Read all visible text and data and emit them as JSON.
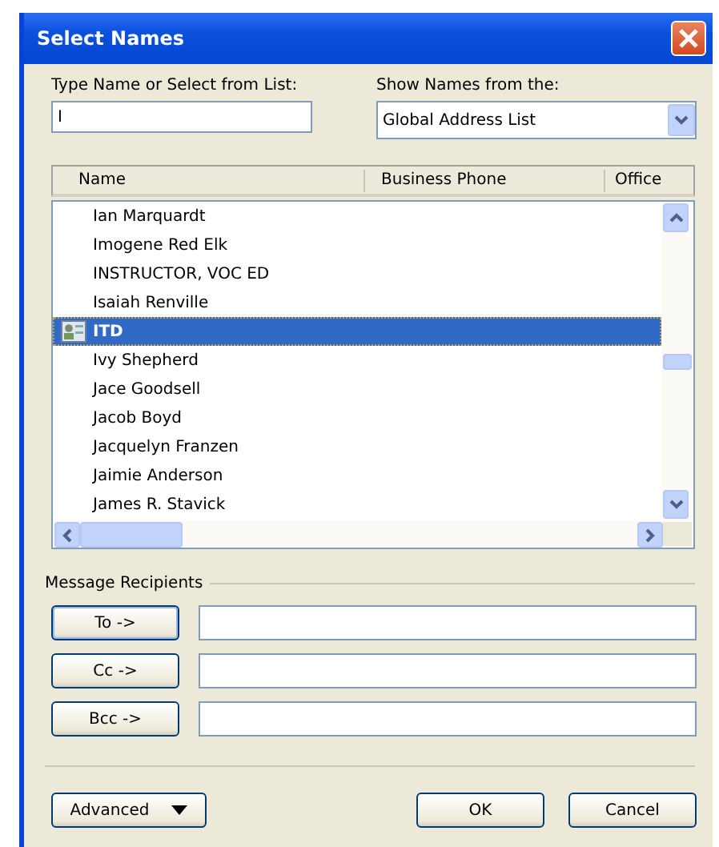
{
  "window": {
    "title": "Select Names"
  },
  "name_field": {
    "label": "Type Name or Select from List:",
    "value": "I"
  },
  "source": {
    "label": "Show Names from the:",
    "value": "Global Address List"
  },
  "list": {
    "columns": [
      "Name",
      "Business Phone",
      "Office"
    ],
    "rows": [
      {
        "name": "Ian Marquardt",
        "kind": "user",
        "selected": false
      },
      {
        "name": "Imogene Red Elk",
        "kind": "user",
        "selected": false
      },
      {
        "name": "INSTRUCTOR, VOC ED",
        "kind": "user",
        "selected": false
      },
      {
        "name": "Isaiah Renville",
        "kind": "user",
        "selected": false
      },
      {
        "name": "ITD",
        "kind": "group",
        "selected": true
      },
      {
        "name": "Ivy Shepherd",
        "kind": "user",
        "selected": false
      },
      {
        "name": "Jace Goodsell",
        "kind": "user",
        "selected": false
      },
      {
        "name": "Jacob Boyd",
        "kind": "user",
        "selected": false
      },
      {
        "name": "Jacquelyn Franzen",
        "kind": "user",
        "selected": false
      },
      {
        "name": "Jaimie Anderson",
        "kind": "user",
        "selected": false
      },
      {
        "name": "James R. Stavick",
        "kind": "user",
        "selected": false
      }
    ]
  },
  "recipients": {
    "label": "Message Recipients",
    "buttons": [
      "To ->",
      "Cc ->",
      "Bcc ->"
    ]
  },
  "footer": {
    "advanced": "Advanced",
    "ok": "OK",
    "cancel": "Cancel"
  }
}
